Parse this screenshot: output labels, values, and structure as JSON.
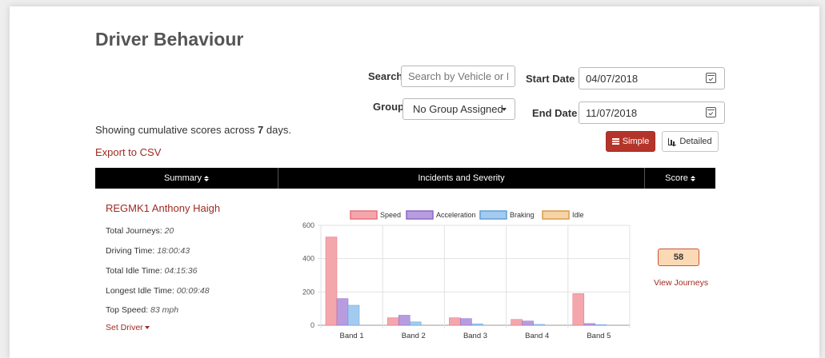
{
  "page": {
    "title": "Driver Behaviour"
  },
  "filters": {
    "search_label": "Search",
    "search_placeholder": "Search by Vehicle or Driv",
    "start_date_label": "Start Date",
    "start_date": "04/07/2018",
    "group_label": "Group",
    "group_value": "No Group Assigned",
    "end_date_label": "End Date",
    "end_date": "11/07/2018"
  },
  "summary_note": {
    "prefix": "Showing cumulative scores across ",
    "days": "7",
    "suffix": " days."
  },
  "export_label": "Export to CSV",
  "view_toggle": {
    "simple": "Simple",
    "detailed": "Detailed",
    "active": "simple"
  },
  "table": {
    "headers": {
      "summary": "Summary",
      "incidents": "Incidents and Severity",
      "score": "Score"
    }
  },
  "driver": {
    "name": "REGMK1 Anthony Haigh",
    "stats": [
      {
        "label": "Total Journeys: ",
        "value": "20"
      },
      {
        "label": "Driving Time: ",
        "value": "18:00:43"
      },
      {
        "label": "Total Idle Time: ",
        "value": "04:15:36"
      },
      {
        "label": "Longest Idle Time: ",
        "value": "00:09:48"
      },
      {
        "label": "Top Speed: ",
        "value": "83 mph"
      }
    ],
    "set_driver": "Set Driver",
    "score": "58",
    "view_journeys": "View Journeys"
  },
  "chart_data": {
    "type": "bar",
    "categories": [
      "Band 1",
      "Band 2",
      "Band 3",
      "Band 4",
      "Band 5"
    ],
    "series": [
      {
        "name": "Speed",
        "values": [
          530,
          45,
          45,
          35,
          190
        ],
        "color": "#f4a6ad",
        "stroke": "#e8707c"
      },
      {
        "name": "Acceleration",
        "values": [
          160,
          60,
          40,
          25,
          10
        ],
        "color": "#b79de0",
        "stroke": "#8a66c6"
      },
      {
        "name": "Braking",
        "values": [
          120,
          20,
          8,
          5,
          3
        ],
        "color": "#a3cbef",
        "stroke": "#5f9fd8"
      },
      {
        "name": "Idle",
        "values": [
          0,
          0,
          0,
          0,
          0
        ],
        "color": "#f7d3a6",
        "stroke": "#d99a4e"
      }
    ],
    "ylim": [
      0,
      600
    ],
    "yticks": [
      0,
      200,
      400,
      600
    ],
    "legend": "top",
    "grid": true
  }
}
